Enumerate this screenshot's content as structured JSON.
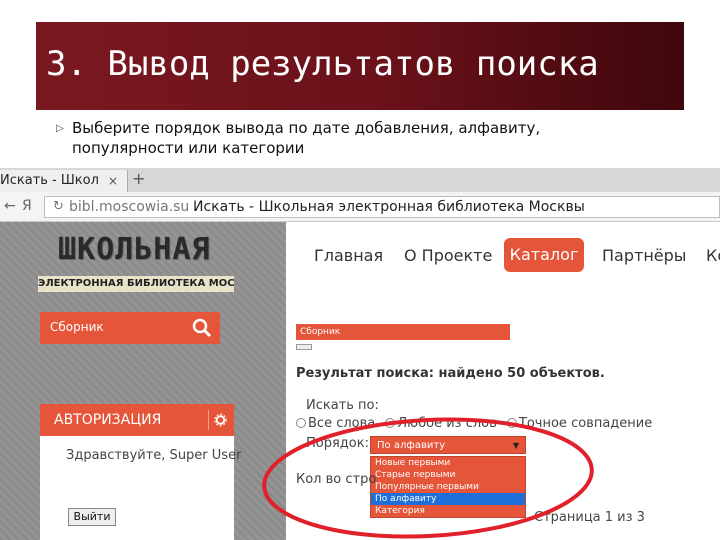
{
  "slide": {
    "title": "3. Вывод результатов поиска",
    "bullet": "Выберите порядок вывода по дате добавления, алфавиту, популярности или категории"
  },
  "browser": {
    "tab_title": "Искать - Школ",
    "tab_close": "×",
    "tab_new": "+",
    "back_glyph": "←",
    "ya_glyph": "Я",
    "url": "bibl.moscowia.su",
    "page_title": "Искать - Школьная электронная библиотека Москвы"
  },
  "site": {
    "logo_big": "ШКОЛЬНАЯ",
    "logo_small": "ЭЛЕКТРОННАЯ БИБЛИОТЕКА МОСКВЫ",
    "search_label": "Сборник",
    "auth_title": "АВТОРИЗАЦИЯ",
    "auth_greeting": "Здравствуйте, Super User",
    "logout_label": "Выйти",
    "nav": {
      "home": "Главная",
      "about": "О Проекте",
      "catalog": "Каталог",
      "partners": "Партнёры",
      "more": "Ко"
    },
    "collection_bar": "Сборник",
    "result_text": "Результат поиска: найдено 50 объектов.",
    "search_by_label": "Искать по:",
    "radio_all": "Все слова",
    "radio_any": "Любое из слов",
    "radio_exact": "Точное совпадение",
    "order_label": "Порядок:",
    "order_selected": "По алфавиту",
    "order_options": [
      "Новые первыми",
      "Старые первыми",
      "Популярные первыми",
      "По алфавиту",
      "Категория"
    ],
    "count_label": "Кол во стро",
    "page_label": "Страница 1 из 3"
  },
  "colors": {
    "title_bar": "#7a1821",
    "accent": "#e4553a",
    "selected_option": "#1e6fd9",
    "annotation": "#e0202a"
  }
}
